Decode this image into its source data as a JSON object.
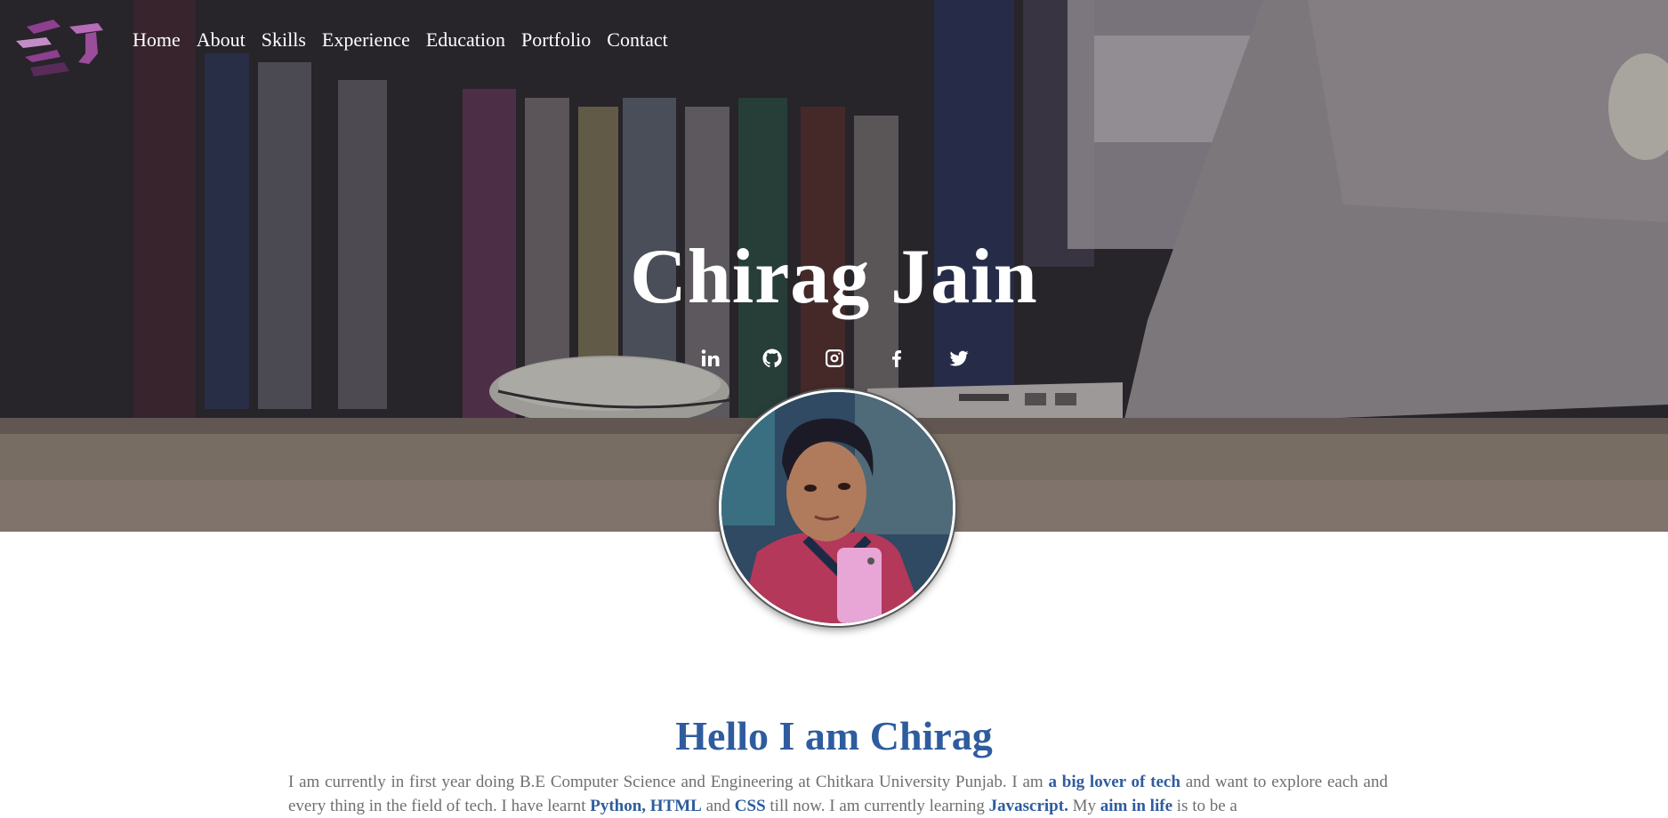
{
  "nav": {
    "logo_alt": "CJ logo",
    "items": [
      "Home",
      "About",
      "Skills",
      "Experience",
      "Education",
      "Portfolio",
      "Contact"
    ]
  },
  "hero": {
    "name": "Chirag Jain",
    "socials": [
      "linkedin-icon",
      "github-icon",
      "instagram-icon",
      "facebook-icon",
      "twitter-icon"
    ]
  },
  "about": {
    "heading": "Hello I am Chirag",
    "p1": "I am currently in first year doing B.E Computer Science and Engineering at Chitkara University Punjab. I am ",
    "h1": "a big lover of tech",
    "p2": " and want to explore each and every thing in the field of tech. I have learnt ",
    "h2": "Python, HTML",
    "p3": " and ",
    "h3": "CSS",
    "p4": " till now. I am currently learning ",
    "h4": "Javascript.",
    "p5": " My ",
    "h5": "aim in life",
    "p6": " is to be a"
  },
  "colors": {
    "accent": "#2e5c9e",
    "body_text": "#6f6f6f",
    "nav_text": "#ffffff"
  }
}
